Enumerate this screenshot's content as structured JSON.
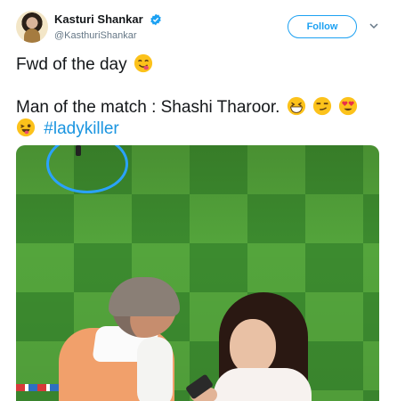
{
  "user": {
    "display_name": "Kasturi Shankar",
    "handle": "@KasthuriShankar",
    "verified": true
  },
  "actions": {
    "follow_label": "Follow"
  },
  "tweet": {
    "line1": "Fwd of the day",
    "line2": "Man of the match : Shashi Tharoor.",
    "hashtag": "#ladykiller",
    "emojis": [
      "savoring-face-icon",
      "grinning-squinting-face-icon",
      "smirking-face-icon",
      "heart-eyes-face-icon",
      "winking-tongue-face-icon"
    ]
  },
  "colors": {
    "accent": "#1da1f2",
    "hashtag": "#1b95e0",
    "text": "#14171a",
    "secondary": "#657786"
  }
}
